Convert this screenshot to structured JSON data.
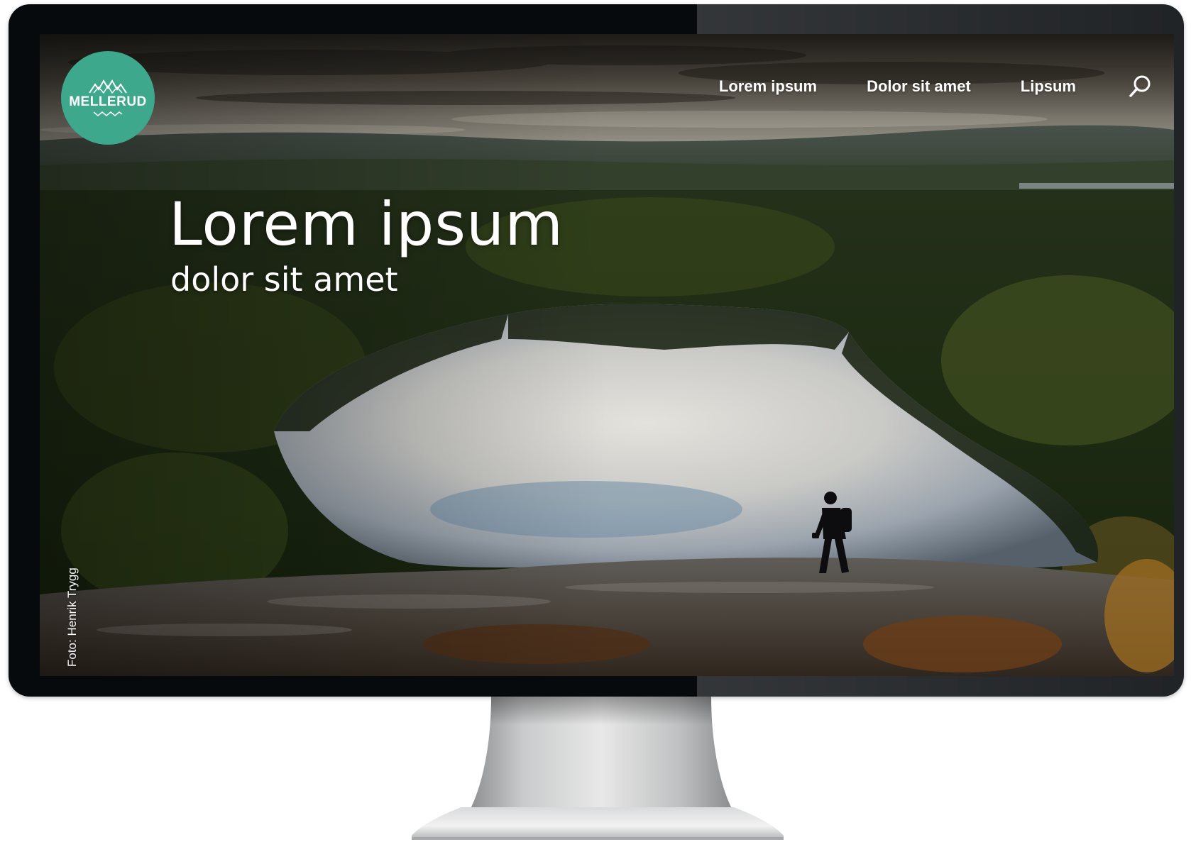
{
  "logo": {
    "text": "MELLERUD",
    "color": "#3ea88c"
  },
  "nav": {
    "items": [
      {
        "label": "Lorem ipsum"
      },
      {
        "label": "Dolor sit amet"
      },
      {
        "label": "Lipsum"
      }
    ],
    "search_icon": "search-icon"
  },
  "hero": {
    "title": "Lorem ipsum",
    "subtitle": "dolor sit amet"
  },
  "credit": "Foto: Henrik Trygg"
}
